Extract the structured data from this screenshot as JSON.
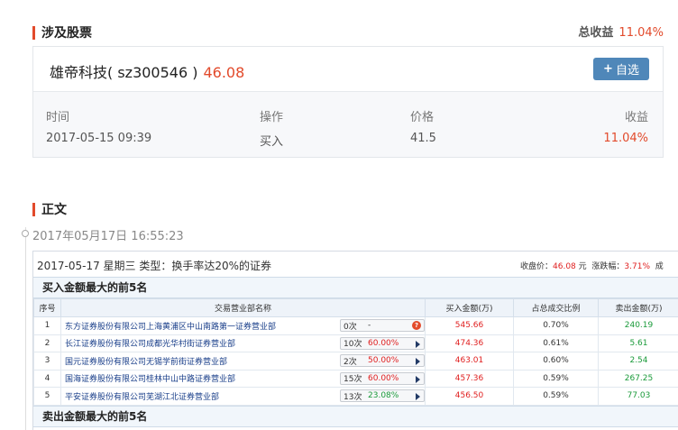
{
  "section1": {
    "title": "涉及股票"
  },
  "total_return": {
    "label": "总收益",
    "value": "11.04%"
  },
  "stock": {
    "name": "雄帝科技( sz300546 )",
    "price": "46.08",
    "add_label": "自选",
    "headers": [
      "时间",
      "操作",
      "价格",
      "收益"
    ],
    "values": [
      "2017-05-15 09:39",
      "买入",
      "41.5",
      "11.04%"
    ]
  },
  "section2": {
    "title": "正文"
  },
  "article": {
    "date": "2017年05月17日 16:55:23"
  },
  "report": {
    "date_line": "2017-05-17 星期三  类型：换手率达20%的证券",
    "close_label": "收盘价：",
    "close_value": "46.08",
    "close_unit": "元",
    "change_label": "涨跌幅：",
    "change_value": "3.71%",
    "more": "成",
    "buy_title": "买入金额最大的前5名",
    "sell_title": "卖出金额最大的前5名",
    "columns": [
      "序号",
      "交易营业部名称",
      "买入金额(万)",
      "占总成交比例",
      "卖出金额(万)"
    ],
    "rows": [
      {
        "no": "1",
        "dept": "东方证券股份有限公司上海黄浦区中山南路第一证券营业部",
        "times": "0次",
        "pct": "-",
        "buy": "545.66",
        "ratio": "0.70%",
        "sell": "240.19",
        "icon": "q"
      },
      {
        "no": "2",
        "dept": "长江证券股份有限公司成都光华村街证券营业部",
        "times": "10次",
        "pct": "60.00%",
        "buy": "474.36",
        "ratio": "0.61%",
        "sell": "5.61",
        "icon": "arrow"
      },
      {
        "no": "3",
        "dept": "国元证券股份有限公司无锡学前街证券营业部",
        "times": "2次",
        "pct": "50.00%",
        "buy": "463.01",
        "ratio": "0.60%",
        "sell": "2.54",
        "icon": "arrow"
      },
      {
        "no": "4",
        "dept": "国海证券股份有限公司桂林中山中路证券营业部",
        "times": "15次",
        "pct": "60.00%",
        "buy": "457.36",
        "ratio": "0.59%",
        "sell": "267.25",
        "icon": "arrow"
      },
      {
        "no": "5",
        "dept": "平安证券股份有限公司芜湖江北证券营业部",
        "times": "13次",
        "pct": "23.08%",
        "buy": "456.50",
        "ratio": "0.59%",
        "sell": "77.03",
        "icon": "arrow",
        "pct_green": true
      }
    ]
  }
}
